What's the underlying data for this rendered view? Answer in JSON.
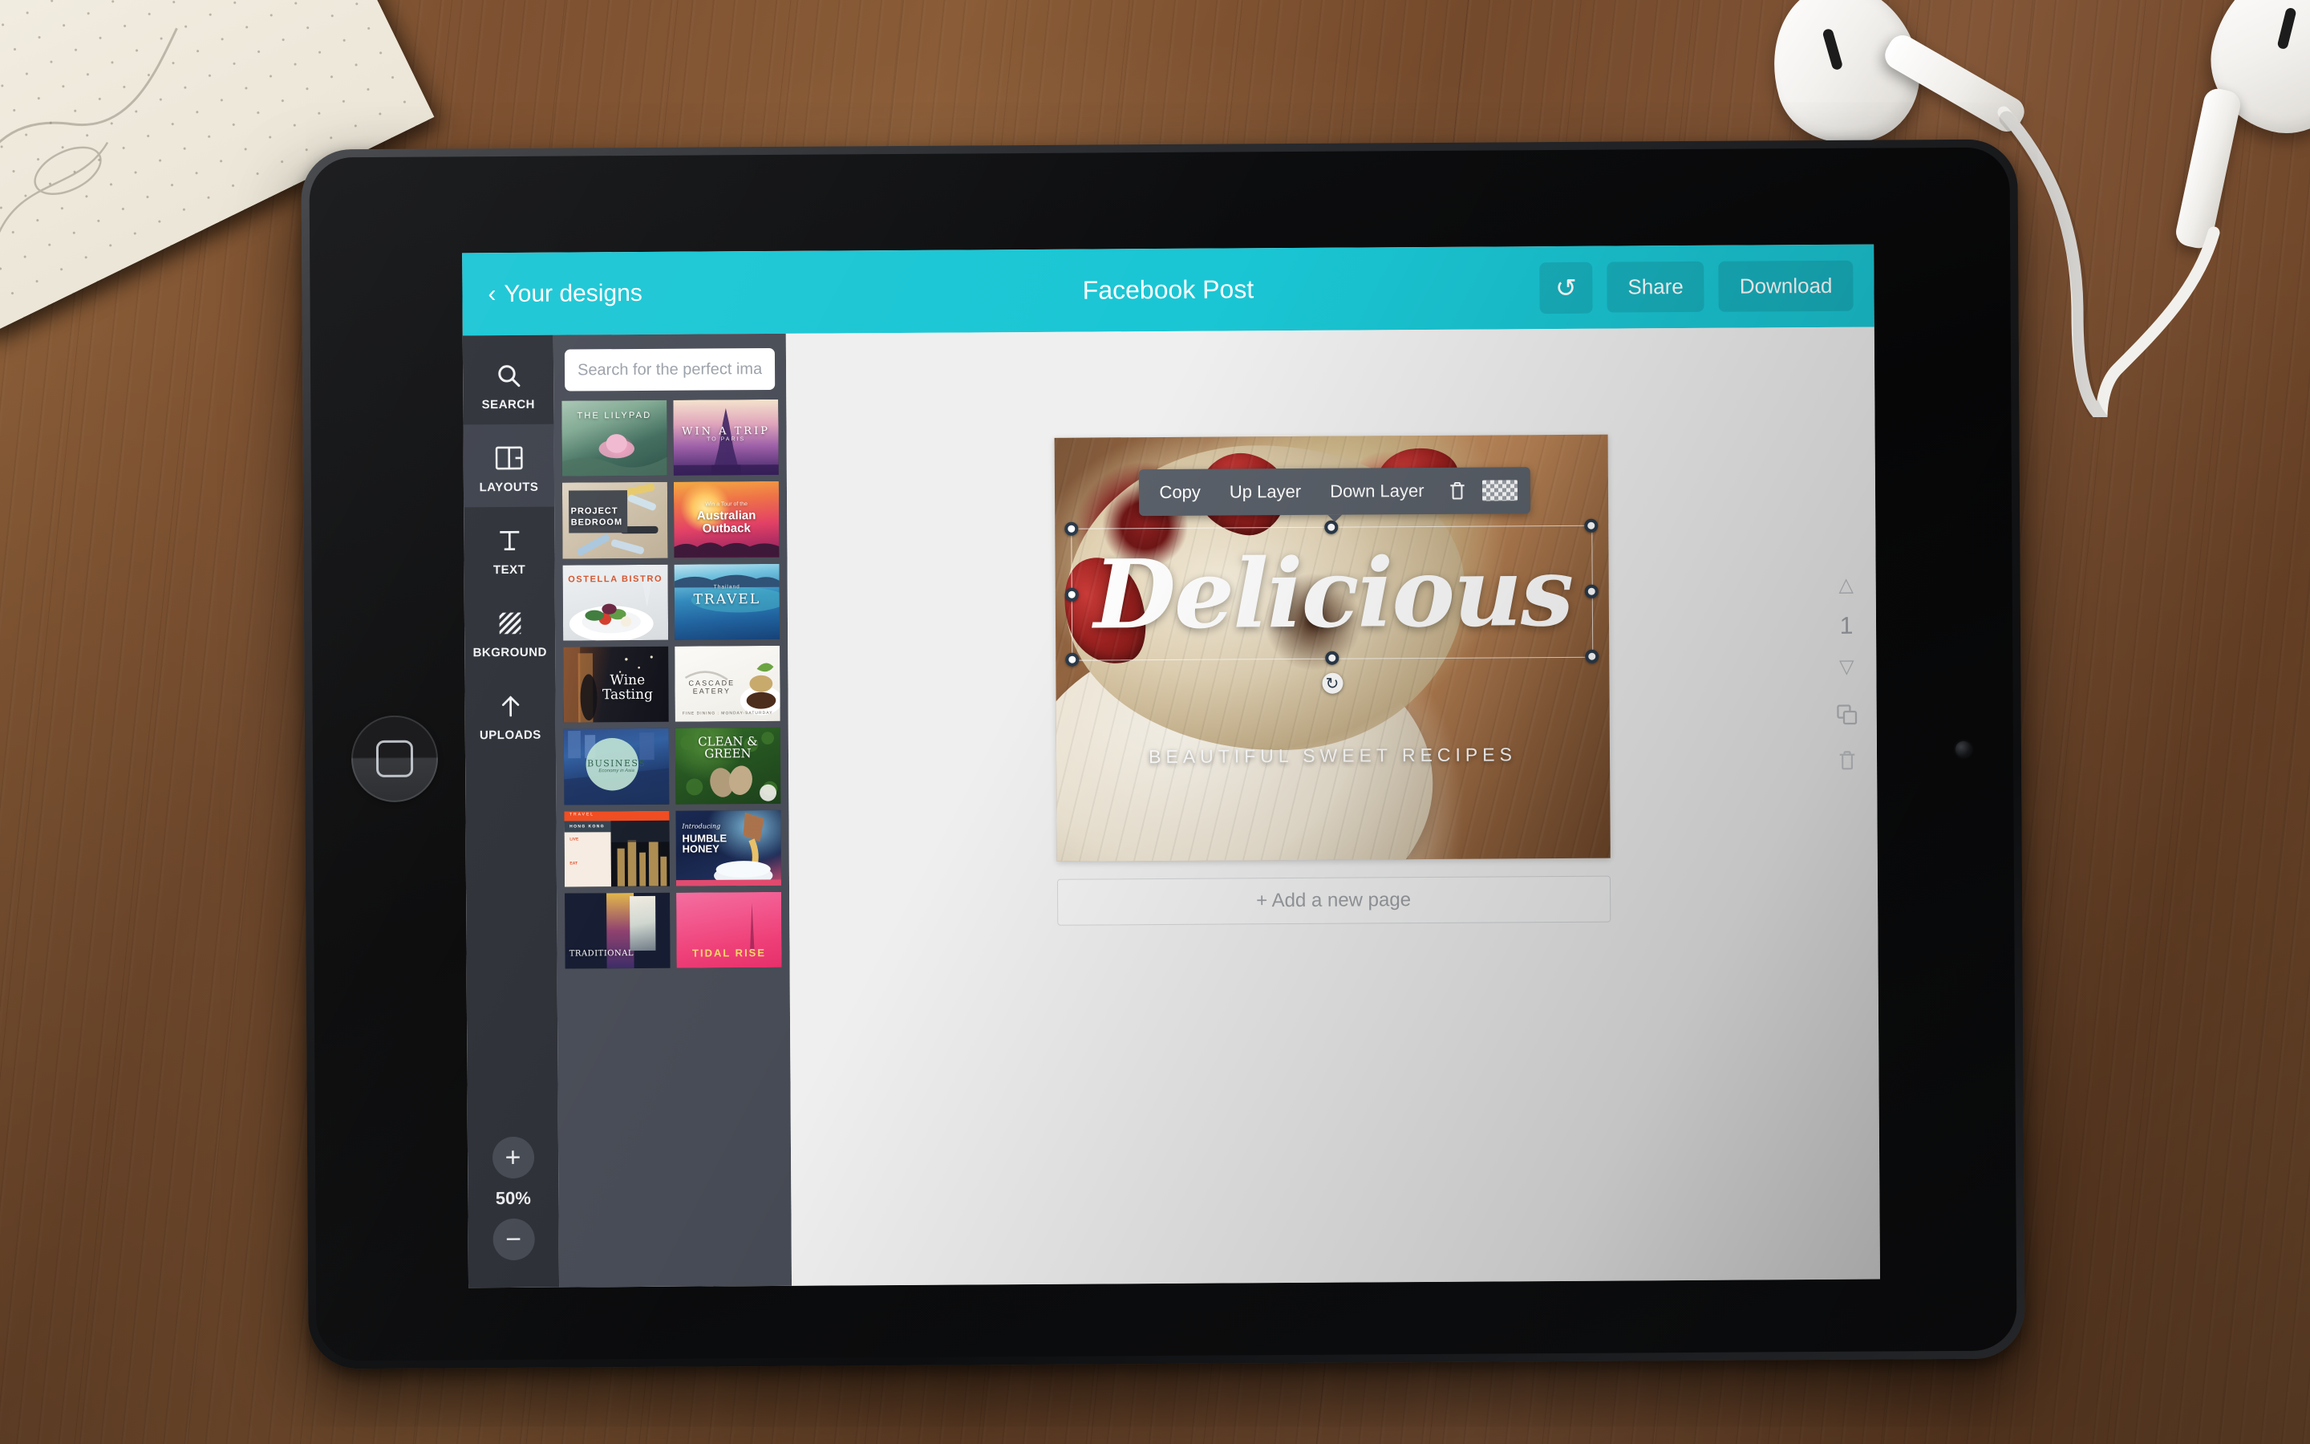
{
  "header": {
    "back_label": "Your designs",
    "back_chevron": "‹",
    "title": "Facebook Post",
    "undo_icon": "↺",
    "share_label": "Share",
    "download_label": "Download",
    "accent_color": "#1ac6d4"
  },
  "rail": {
    "items": [
      {
        "id": "search",
        "label": "SEARCH",
        "icon": "search-icon",
        "active": false
      },
      {
        "id": "layouts",
        "label": "LAYOUTS",
        "icon": "layouts-icon",
        "active": true
      },
      {
        "id": "text",
        "label": "TEXT",
        "icon": "text-icon",
        "active": false
      },
      {
        "id": "bkground",
        "label": "BKGROUND",
        "icon": "background-icon",
        "active": false
      },
      {
        "id": "uploads",
        "label": "UPLOADS",
        "icon": "upload-arrow-icon",
        "active": false
      }
    ],
    "zoom": {
      "in_label": "+",
      "out_label": "−",
      "level": "50%"
    }
  },
  "panel": {
    "search_placeholder": "Search for the perfect image",
    "search_value": "",
    "templates": [
      {
        "title": "THE LILYPAD",
        "subtitle": "",
        "theme": "lilypad"
      },
      {
        "title": "WIN A TRIP",
        "subtitle": "TO PARIS",
        "theme": "paris"
      },
      {
        "title": "PROJECT BEDROOM",
        "subtitle": "",
        "theme": "bedroom"
      },
      {
        "title": "Australian Outback",
        "subtitle": "Win a Tour of the",
        "theme": "outback"
      },
      {
        "title": "OSTELLA BISTRO",
        "subtitle": "",
        "theme": "bistro"
      },
      {
        "title": "TRAVEL",
        "subtitle": "Thailand",
        "theme": "travel"
      },
      {
        "title": "Wine Tasting",
        "subtitle": "",
        "theme": "wine"
      },
      {
        "title": "CASCADE EATERY",
        "subtitle": "FINE DINING : MONDAY-SATURDAY",
        "theme": "cascade"
      },
      {
        "title": "BUSINESS",
        "subtitle": "Economy in Asia",
        "theme": "business"
      },
      {
        "title": "CLEAN & GREEN",
        "subtitle": "",
        "theme": "clean"
      },
      {
        "title": "HONG KONG",
        "subtitle": "TRAVEL",
        "theme": "hongkong"
      },
      {
        "title": "HUMBLE HONEY",
        "subtitle": "Introducing",
        "theme": "honey"
      },
      {
        "title": "TRADITIONAL",
        "subtitle": "",
        "theme": "traditional"
      },
      {
        "title": "TIDAL RISE",
        "subtitle": "",
        "theme": "tidal"
      }
    ]
  },
  "canvas": {
    "design": {
      "title": "Delicious",
      "subtitle": "BEAUTIFUL SWEET RECIPES"
    },
    "context_menu": {
      "copy_label": "Copy",
      "up_layer_label": "Up Layer",
      "down_layer_label": "Down Layer",
      "delete_icon": "trash-icon",
      "transparency_icon": "transparency-icon"
    },
    "selection": {
      "rotate_icon": "↻"
    },
    "page_controls": {
      "up_icon": "△",
      "page_number": "1",
      "down_icon": "▽",
      "duplicate_icon": "duplicate-icon",
      "delete_icon": "trash-icon"
    },
    "add_page_label": "+ Add a new page"
  }
}
